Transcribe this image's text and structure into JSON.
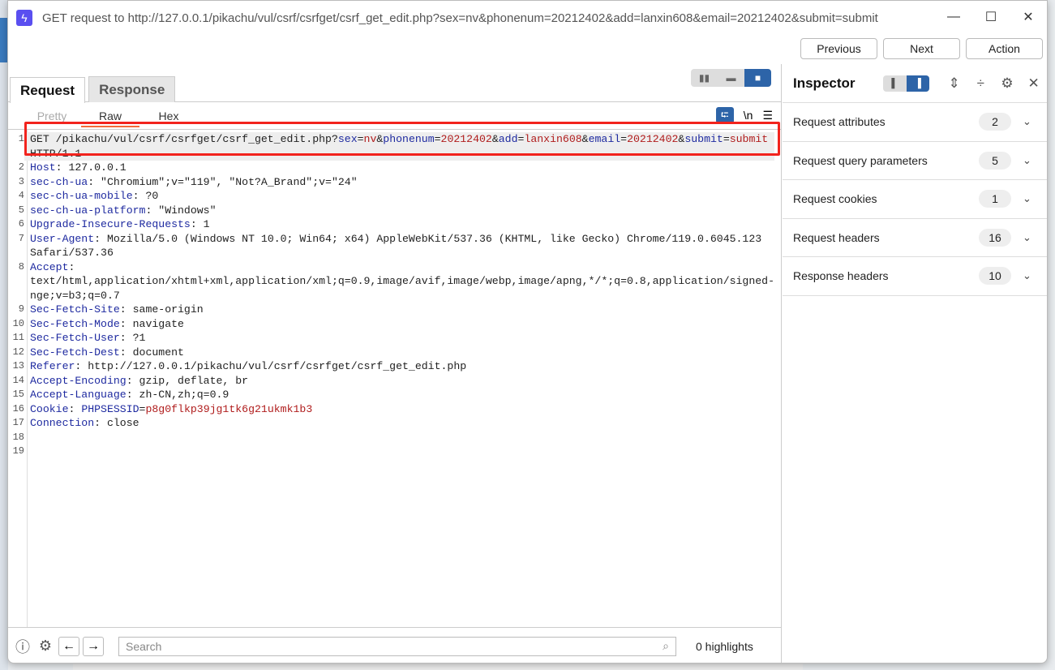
{
  "window": {
    "title": "GET request to http://127.0.0.1/pikachu/vul/csrf/csrfget/csrf_get_edit.php?sex=nv&phonenum=20212402&add=lanxin608&email=20212402&submit=submit",
    "minimize": "—",
    "maximize": "☐",
    "close": "✕"
  },
  "nav": {
    "previous": "Previous",
    "next": "Next",
    "action": "Action"
  },
  "tabs": {
    "request": "Request",
    "response": "Response"
  },
  "subtabs": {
    "pretty": "Pretty",
    "raw": "Raw",
    "hex": "Hex"
  },
  "editor_tools": {
    "wrap": "⮓",
    "newline": "\\n",
    "menu": "☰"
  },
  "request_lines": [
    {
      "n": "1",
      "seg": [
        [
          "t",
          "GET /pikachu/vul/csrf/csrfget/csrf_get_edit.php?"
        ],
        [
          "k",
          "sex"
        ],
        [
          "t",
          "="
        ],
        [
          "v",
          "nv"
        ],
        [
          "t",
          "&"
        ],
        [
          "k",
          "phonenum"
        ],
        [
          "t",
          "="
        ],
        [
          "v",
          "20212402"
        ],
        [
          "t",
          "&"
        ],
        [
          "k",
          "add"
        ],
        [
          "t",
          "="
        ],
        [
          "v",
          "lanxin608"
        ],
        [
          "t",
          "&"
        ],
        [
          "k",
          "email"
        ],
        [
          "t",
          "="
        ],
        [
          "v",
          "20212402"
        ],
        [
          "t",
          "&"
        ],
        [
          "k",
          "submit"
        ],
        [
          "t",
          "="
        ],
        [
          "v",
          "submit"
        ]
      ]
    },
    {
      "n": "",
      "seg": [
        [
          "t",
          "HTTP/1.1"
        ]
      ]
    },
    {
      "n": "2",
      "seg": [
        [
          "k",
          "Host"
        ],
        [
          "t",
          ": 127.0.0.1"
        ]
      ]
    },
    {
      "n": "3",
      "seg": [
        [
          "k",
          "sec-ch-ua"
        ],
        [
          "t",
          ": \"Chromium\";v=\"119\", \"Not?A_Brand\";v=\"24\""
        ]
      ]
    },
    {
      "n": "4",
      "seg": [
        [
          "k",
          "sec-ch-ua-mobile"
        ],
        [
          "t",
          ": ?0"
        ]
      ]
    },
    {
      "n": "5",
      "seg": [
        [
          "k",
          "sec-ch-ua-platform"
        ],
        [
          "t",
          ": \"Windows\""
        ]
      ]
    },
    {
      "n": "6",
      "seg": [
        [
          "k",
          "Upgrade-Insecure-Requests"
        ],
        [
          "t",
          ": 1"
        ]
      ]
    },
    {
      "n": "7",
      "seg": [
        [
          "k",
          "User-Agent"
        ],
        [
          "t",
          ": Mozilla/5.0 (Windows NT 10.0; Win64; x64) AppleWebKit/537.36 (KHTML, like Gecko) Chrome/119.0.6045.123"
        ]
      ]
    },
    {
      "n": "",
      "seg": [
        [
          "t",
          "Safari/537.36"
        ]
      ]
    },
    {
      "n": "8",
      "seg": [
        [
          "k",
          "Accept"
        ],
        [
          "t",
          ":"
        ]
      ]
    },
    {
      "n": "",
      "seg": [
        [
          "t",
          "text/html,application/xhtml+xml,application/xml;q=0.9,image/avif,image/webp,image/apng,*/*;q=0.8,application/signed-excha"
        ]
      ]
    },
    {
      "n": "",
      "seg": [
        [
          "t",
          "nge;v=b3;q=0.7"
        ]
      ]
    },
    {
      "n": "9",
      "seg": [
        [
          "k",
          "Sec-Fetch-Site"
        ],
        [
          "t",
          ": same-origin"
        ]
      ]
    },
    {
      "n": "10",
      "seg": [
        [
          "k",
          "Sec-Fetch-Mode"
        ],
        [
          "t",
          ": navigate"
        ]
      ]
    },
    {
      "n": "11",
      "seg": [
        [
          "k",
          "Sec-Fetch-User"
        ],
        [
          "t",
          ": ?1"
        ]
      ]
    },
    {
      "n": "12",
      "seg": [
        [
          "k",
          "Sec-Fetch-Dest"
        ],
        [
          "t",
          ": document"
        ]
      ]
    },
    {
      "n": "13",
      "seg": [
        [
          "k",
          "Referer"
        ],
        [
          "t",
          ": http://127.0.0.1/pikachu/vul/csrf/csrfget/csrf_get_edit.php"
        ]
      ]
    },
    {
      "n": "14",
      "seg": [
        [
          "k",
          "Accept-Encoding"
        ],
        [
          "t",
          ": gzip, deflate, br"
        ]
      ]
    },
    {
      "n": "15",
      "seg": [
        [
          "k",
          "Accept-Language"
        ],
        [
          "t",
          ": zh-CN,zh;q=0.9"
        ]
      ]
    },
    {
      "n": "16",
      "seg": [
        [
          "k",
          "Cookie"
        ],
        [
          "t",
          ": "
        ],
        [
          "k",
          "PHPSESSID"
        ],
        [
          "t",
          "="
        ],
        [
          "v",
          "p8g0flkp39jg1tk6g21ukmk1b3"
        ]
      ]
    },
    {
      "n": "17",
      "seg": [
        [
          "k",
          "Connection"
        ],
        [
          "t",
          ": close"
        ]
      ]
    },
    {
      "n": "18",
      "seg": []
    },
    {
      "n": "19",
      "seg": []
    }
  ],
  "bottom": {
    "search_placeholder": "Search",
    "highlights": "0 highlights"
  },
  "inspector": {
    "title": "Inspector",
    "sections": [
      {
        "label": "Request attributes",
        "count": "2"
      },
      {
        "label": "Request query parameters",
        "count": "5"
      },
      {
        "label": "Request cookies",
        "count": "1"
      },
      {
        "label": "Request headers",
        "count": "16"
      },
      {
        "label": "Response headers",
        "count": "10"
      }
    ]
  }
}
